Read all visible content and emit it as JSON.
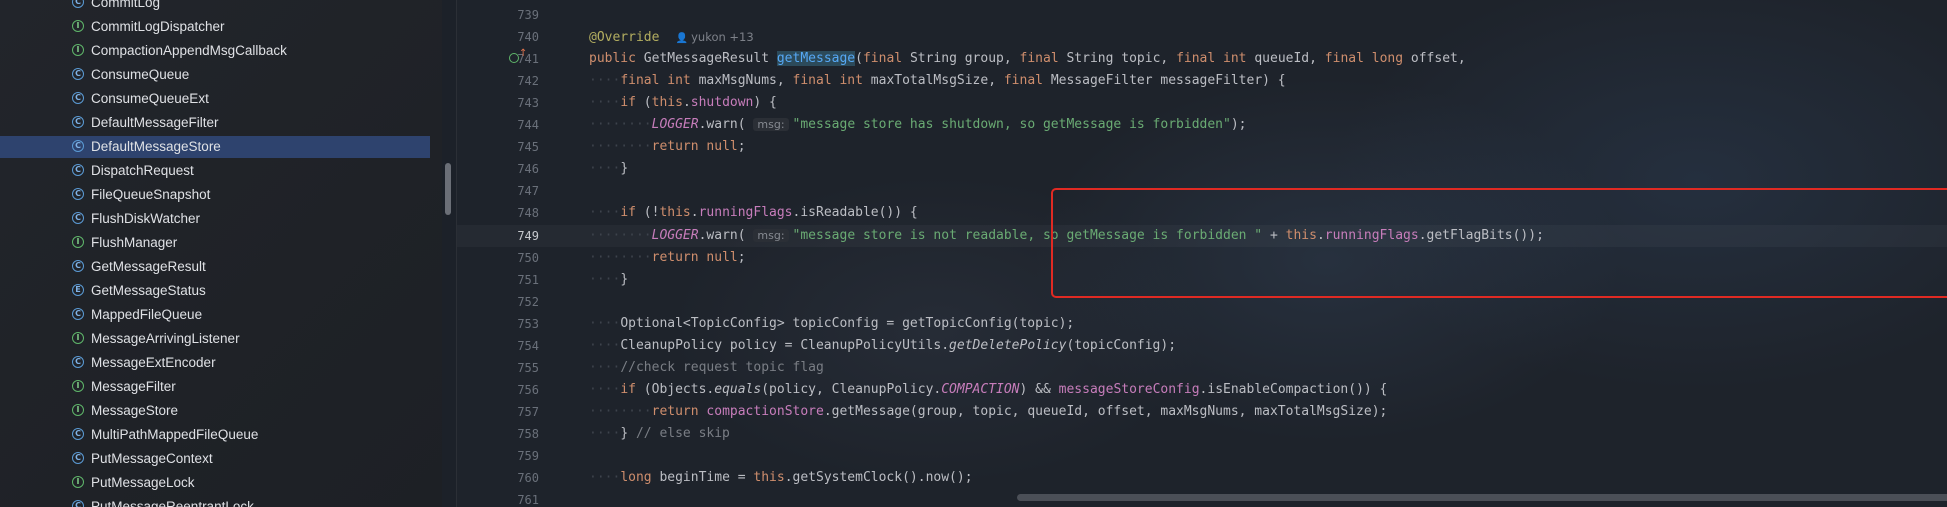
{
  "project_tree": {
    "items": [
      {
        "icon": "class-icon",
        "glyph": "C",
        "label": "CommitLog"
      },
      {
        "icon": "interface-icon",
        "glyph": "I",
        "label": "CommitLogDispatcher"
      },
      {
        "icon": "interface-icon",
        "glyph": "I",
        "label": "CompactionAppendMsgCallback"
      },
      {
        "icon": "class-icon",
        "glyph": "C",
        "label": "ConsumeQueue"
      },
      {
        "icon": "class-icon",
        "glyph": "C",
        "label": "ConsumeQueueExt"
      },
      {
        "icon": "class-icon",
        "glyph": "C",
        "label": "DefaultMessageFilter"
      },
      {
        "icon": "class-icon",
        "glyph": "C",
        "label": "DefaultMessageStore",
        "selected": true
      },
      {
        "icon": "class-icon",
        "glyph": "C",
        "label": "DispatchRequest"
      },
      {
        "icon": "class-icon",
        "glyph": "C",
        "label": "FileQueueSnapshot"
      },
      {
        "icon": "class-icon",
        "glyph": "C",
        "label": "FlushDiskWatcher"
      },
      {
        "icon": "interface-icon",
        "glyph": "I",
        "label": "FlushManager"
      },
      {
        "icon": "class-icon",
        "glyph": "C",
        "label": "GetMessageResult"
      },
      {
        "icon": "enum-icon",
        "glyph": "E",
        "label": "GetMessageStatus"
      },
      {
        "icon": "class-icon",
        "glyph": "C",
        "label": "MappedFileQueue"
      },
      {
        "icon": "interface-icon",
        "glyph": "I",
        "label": "MessageArrivingListener"
      },
      {
        "icon": "class-icon",
        "glyph": "C",
        "label": "MessageExtEncoder"
      },
      {
        "icon": "interface-icon",
        "glyph": "I",
        "label": "MessageFilter"
      },
      {
        "icon": "interface-icon",
        "glyph": "I",
        "label": "MessageStore"
      },
      {
        "icon": "class-icon",
        "glyph": "C",
        "label": "MultiPathMappedFileQueue"
      },
      {
        "icon": "class-icon",
        "glyph": "C",
        "label": "PutMessageContext"
      },
      {
        "icon": "interface-icon",
        "glyph": "I",
        "label": "PutMessageLock"
      },
      {
        "icon": "class-icon",
        "glyph": "C",
        "label": "PutMessageReentrantLock"
      }
    ]
  },
  "editor": {
    "current_line": "749",
    "author_hint": "yukon +13",
    "lines": [
      {
        "n": "739",
        "indent": "",
        "tokens": []
      },
      {
        "n": "740",
        "indent": "",
        "tokens": [
          {
            "t": "ann",
            "v": "@Override"
          }
        ],
        "author": true
      },
      {
        "n": "741",
        "indent": "",
        "gutter": true,
        "tokens": [
          {
            "t": "kw",
            "v": "public "
          },
          {
            "t": "",
            "v": "GetMessageResult "
          },
          {
            "t": "fnhl",
            "v": "getMessage"
          },
          {
            "t": "",
            "v": "("
          },
          {
            "t": "kw",
            "v": "final "
          },
          {
            "t": "",
            "v": "String group, "
          },
          {
            "t": "kw",
            "v": "final "
          },
          {
            "t": "",
            "v": "String topic, "
          },
          {
            "t": "kw",
            "v": "final int "
          },
          {
            "t": "",
            "v": "queueId, "
          },
          {
            "t": "kw",
            "v": "final long "
          },
          {
            "t": "",
            "v": "offset,"
          }
        ]
      },
      {
        "n": "742",
        "indent": "····",
        "tokens": [
          {
            "t": "kw",
            "v": "final int "
          },
          {
            "t": "",
            "v": "maxMsgNums, "
          },
          {
            "t": "kw",
            "v": "final int "
          },
          {
            "t": "",
            "v": "maxTotalMsgSize, "
          },
          {
            "t": "kw",
            "v": "final "
          },
          {
            "t": "",
            "v": "MessageFilter messageFilter) {"
          }
        ]
      },
      {
        "n": "743",
        "indent": "····",
        "tokens": [
          {
            "t": "kw",
            "v": "if "
          },
          {
            "t": "",
            "v": "("
          },
          {
            "t": "kw",
            "v": "this"
          },
          {
            "t": "",
            "v": "."
          },
          {
            "t": "fld",
            "v": "shutdown"
          },
          {
            "t": "",
            "v": ") {"
          }
        ]
      },
      {
        "n": "744",
        "indent": "········",
        "tokens": [
          {
            "t": "st",
            "v": "LOGGER"
          },
          {
            "t": "",
            "v": ".warn( "
          },
          {
            "t": "hint",
            "v": "msg:"
          },
          {
            "t": "str",
            "v": "\"message store has shutdown, so getMessage is forbidden\""
          },
          {
            "t": "",
            "v": ");"
          }
        ]
      },
      {
        "n": "745",
        "indent": "········",
        "tokens": [
          {
            "t": "kw",
            "v": "return null"
          },
          {
            "t": "",
            "v": ";"
          }
        ]
      },
      {
        "n": "746",
        "indent": "····",
        "tokens": [
          {
            "t": "",
            "v": "}"
          }
        ]
      },
      {
        "n": "747",
        "indent": "",
        "tokens": []
      },
      {
        "n": "748",
        "indent": "····",
        "tokens": [
          {
            "t": "kw",
            "v": "if "
          },
          {
            "t": "",
            "v": "(!"
          },
          {
            "t": "kw",
            "v": "this"
          },
          {
            "t": "",
            "v": "."
          },
          {
            "t": "fld",
            "v": "runningFlags"
          },
          {
            "t": "",
            "v": ".isReadable()) {"
          }
        ]
      },
      {
        "n": "749",
        "indent": "········",
        "current": true,
        "tokens": [
          {
            "t": "st",
            "v": "LOGGER"
          },
          {
            "t": "",
            "v": ".warn( "
          },
          {
            "t": "hint",
            "v": "msg:"
          },
          {
            "t": "str",
            "v": "\"message store is not readable, so getMessage is forbidden \""
          },
          {
            "t": "",
            "v": " + "
          },
          {
            "t": "kw",
            "v": "this"
          },
          {
            "t": "",
            "v": "."
          },
          {
            "t": "fld",
            "v": "runningFlags"
          },
          {
            "t": "",
            "v": ".getFlagBits());"
          }
        ]
      },
      {
        "n": "750",
        "indent": "········",
        "tokens": [
          {
            "t": "kw",
            "v": "return null"
          },
          {
            "t": "",
            "v": ";"
          }
        ]
      },
      {
        "n": "751",
        "indent": "····",
        "tokens": [
          {
            "t": "",
            "v": "}"
          }
        ]
      },
      {
        "n": "752",
        "indent": "",
        "tokens": []
      },
      {
        "n": "753",
        "indent": "····",
        "tokens": [
          {
            "t": "",
            "v": "Optional<TopicConfig> topicConfig = getTopicConfig(topic);"
          }
        ]
      },
      {
        "n": "754",
        "indent": "····",
        "tokens": [
          {
            "t": "",
            "v": "CleanupPolicy policy = CleanupPolicyUtils."
          },
          {
            "t": "it",
            "v": "getDeletePolicy"
          },
          {
            "t": "",
            "v": "(topicConfig);"
          }
        ]
      },
      {
        "n": "755",
        "indent": "····",
        "tokens": [
          {
            "t": "cmt",
            "v": "//check request topic flag"
          }
        ]
      },
      {
        "n": "756",
        "indent": "····",
        "tokens": [
          {
            "t": "kw",
            "v": "if "
          },
          {
            "t": "",
            "v": "(Objects."
          },
          {
            "t": "it",
            "v": "equals"
          },
          {
            "t": "",
            "v": "(policy, CleanupPolicy."
          },
          {
            "t": "st",
            "v": "COMPACTION"
          },
          {
            "t": "",
            "v": ") && "
          },
          {
            "t": "fld",
            "v": "messageStoreConfig"
          },
          {
            "t": "",
            "v": ".isEnableCompaction()) {"
          }
        ]
      },
      {
        "n": "757",
        "indent": "········",
        "tokens": [
          {
            "t": "kw",
            "v": "return "
          },
          {
            "t": "fld",
            "v": "compactionStore"
          },
          {
            "t": "",
            "v": ".getMessage(group, topic, queueId, offset, maxMsgNums, maxTotalMsgSize);"
          }
        ]
      },
      {
        "n": "758",
        "indent": "····",
        "tokens": [
          {
            "t": "",
            "v": "} "
          },
          {
            "t": "cmt",
            "v": "// else skip"
          }
        ]
      },
      {
        "n": "759",
        "indent": "",
        "tokens": []
      },
      {
        "n": "760",
        "indent": "····",
        "tokens": [
          {
            "t": "kw",
            "v": "long "
          },
          {
            "t": "",
            "v": "beginTime = "
          },
          {
            "t": "kw",
            "v": "this"
          },
          {
            "t": "",
            "v": ".getSystemClock().now();"
          }
        ]
      },
      {
        "n": "761",
        "indent": "",
        "tokens": []
      }
    ]
  },
  "colors": {
    "selection": "#2e436e",
    "highlight_box": "#e02a23",
    "keyword": "#cf8e6d",
    "string": "#6aab73",
    "field": "#c77dbb"
  }
}
